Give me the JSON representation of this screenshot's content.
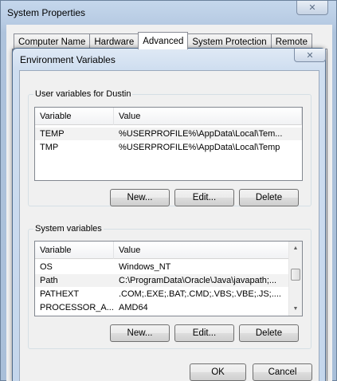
{
  "parent_window": {
    "title": "System Properties",
    "close_glyph": "✕",
    "tabs": [
      {
        "label": "Computer Name",
        "active": false
      },
      {
        "label": "Hardware",
        "active": false
      },
      {
        "label": "Advanced",
        "active": true
      },
      {
        "label": "System Protection",
        "active": false
      },
      {
        "label": "Remote",
        "active": false
      }
    ]
  },
  "dialog": {
    "title": "Environment Variables",
    "close_glyph": "✕",
    "user_group": {
      "label": "User variables for Dustin",
      "columns": [
        "Variable",
        "Value"
      ],
      "rows": [
        {
          "variable": "TEMP",
          "value": "%USERPROFILE%\\AppData\\Local\\Tem...",
          "selected": true
        },
        {
          "variable": "TMP",
          "value": "%USERPROFILE%\\AppData\\Local\\Temp",
          "selected": false
        }
      ],
      "buttons": {
        "new": "New...",
        "edit": "Edit...",
        "delete": "Delete"
      }
    },
    "system_group": {
      "label": "System variables",
      "columns": [
        "Variable",
        "Value"
      ],
      "rows": [
        {
          "variable": "OS",
          "value": "Windows_NT",
          "selected": false
        },
        {
          "variable": "Path",
          "value": "C:\\ProgramData\\Oracle\\Java\\javapath;...",
          "selected": true
        },
        {
          "variable": "PATHEXT",
          "value": ".COM;.EXE;.BAT;.CMD;.VBS;.VBE;.JS;....",
          "selected": false
        },
        {
          "variable": "PROCESSOR_A...",
          "value": "AMD64",
          "selected": false
        }
      ],
      "scrollbar": {
        "up_glyph": "▲",
        "down_glyph": "▼"
      },
      "buttons": {
        "new": "New...",
        "edit": "Edit...",
        "delete": "Delete"
      }
    },
    "footer": {
      "ok": "OK",
      "cancel": "Cancel"
    }
  }
}
